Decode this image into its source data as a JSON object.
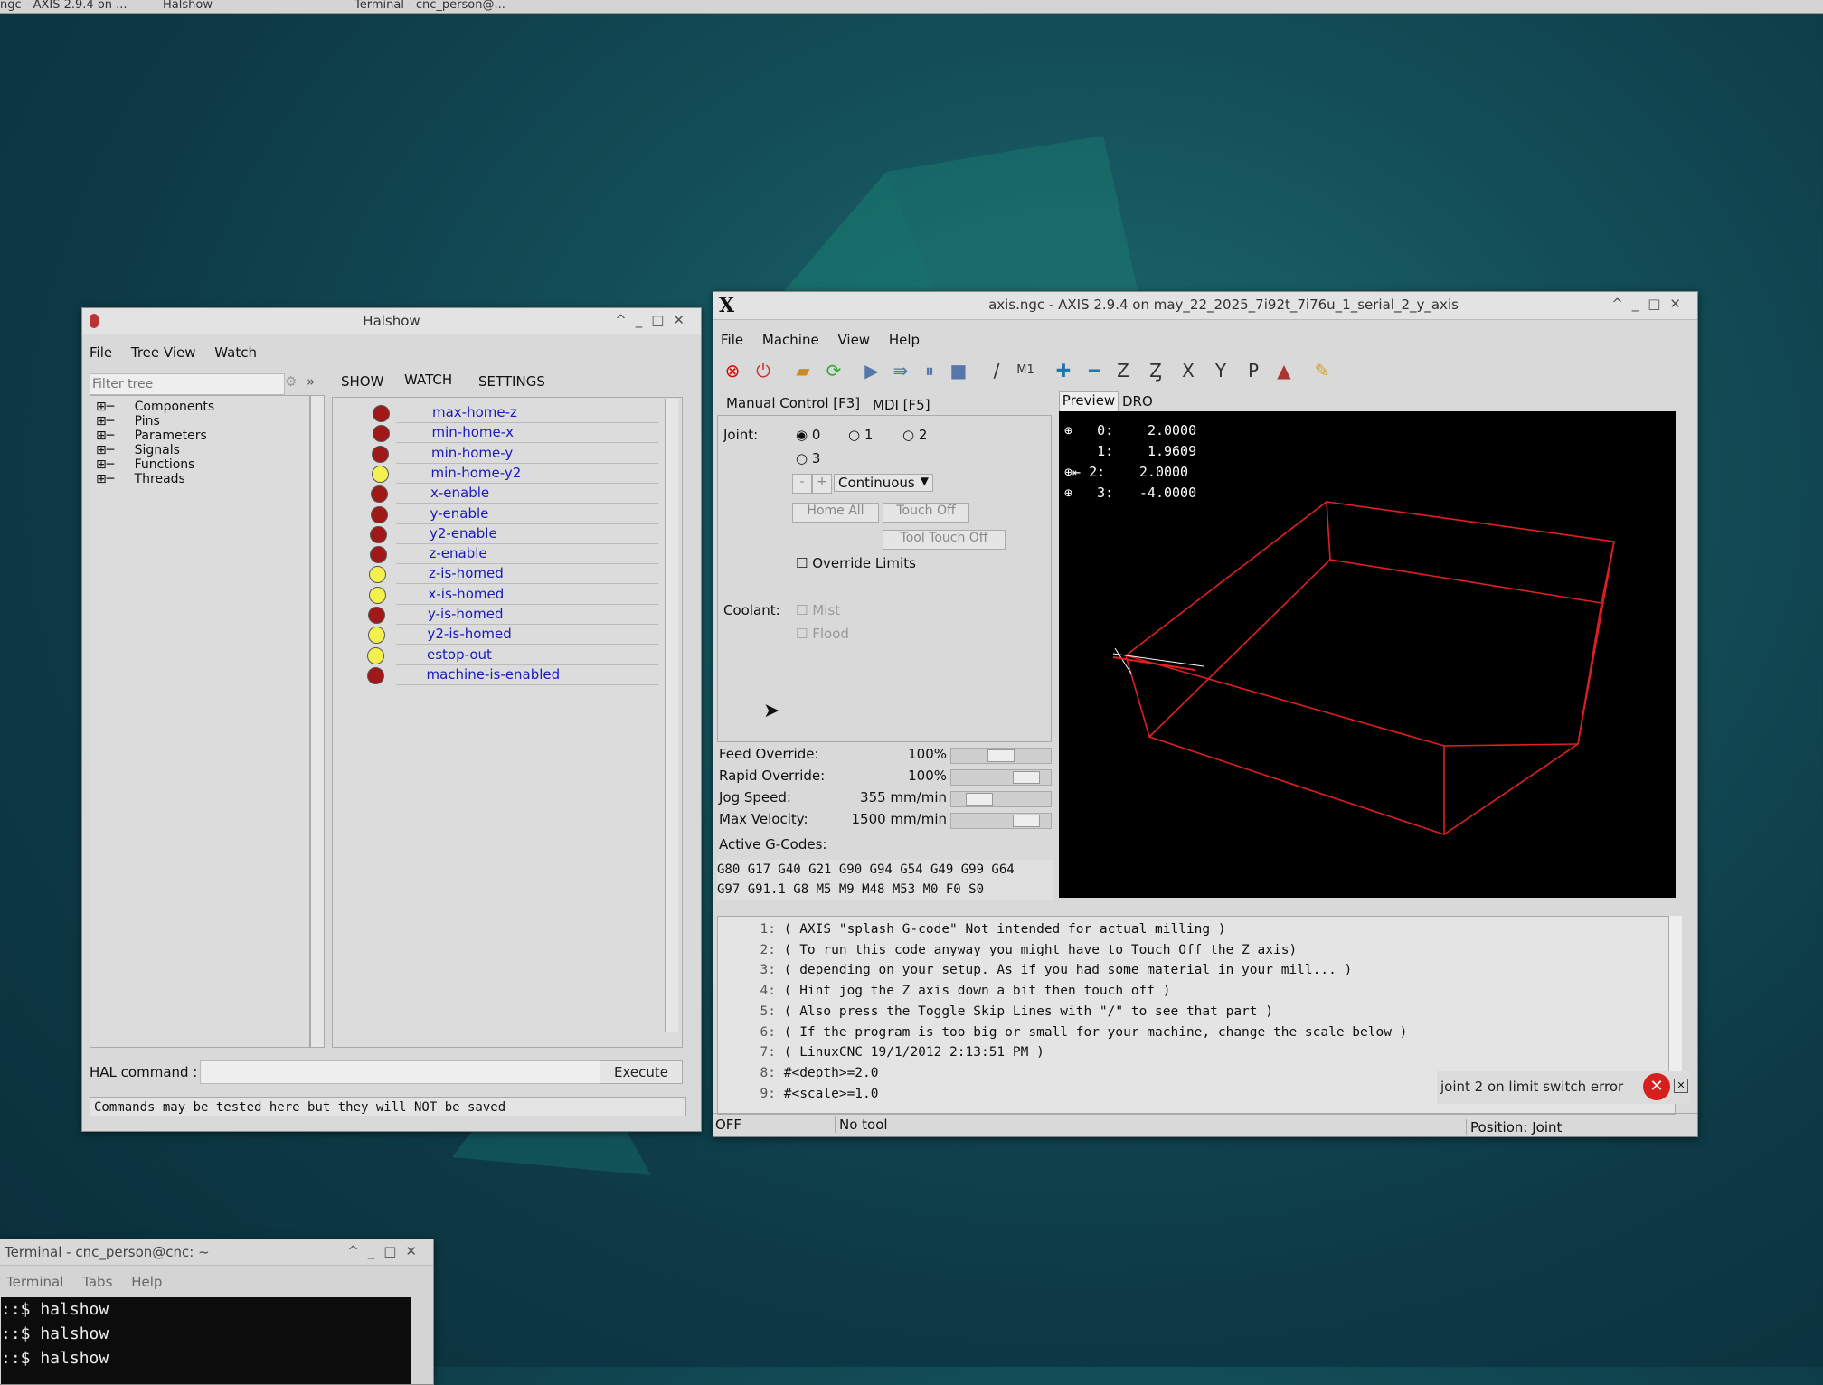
{
  "taskbar": {
    "items": [
      "ngc - AXIS 2.9.4 on ...",
      "Halshow",
      "Terminal - cnc_person@..."
    ]
  },
  "halshow": {
    "title": "Halshow",
    "menu": [
      "File",
      "Tree View",
      "Watch"
    ],
    "filter_placeholder": "Filter tree",
    "tabs": [
      "SHOW",
      "WATCH",
      "SETTINGS"
    ],
    "tree": [
      "Components",
      "Pins",
      "Parameters",
      "Signals",
      "Functions",
      "Threads"
    ],
    "watch": [
      {
        "name": "max-home-z",
        "state": "red"
      },
      {
        "name": "min-home-x",
        "state": "red"
      },
      {
        "name": "min-home-y",
        "state": "red"
      },
      {
        "name": "min-home-y2",
        "state": "yellow"
      },
      {
        "name": "x-enable",
        "state": "red"
      },
      {
        "name": "y-enable",
        "state": "red"
      },
      {
        "name": "y2-enable",
        "state": "red"
      },
      {
        "name": "z-enable",
        "state": "red"
      },
      {
        "name": "z-is-homed",
        "state": "yellow"
      },
      {
        "name": "x-is-homed",
        "state": "yellow"
      },
      {
        "name": "y-is-homed",
        "state": "red"
      },
      {
        "name": "y2-is-homed",
        "state": "yellow"
      },
      {
        "name": "estop-out",
        "state": "yellow"
      },
      {
        "name": "machine-is-enabled",
        "state": "red"
      }
    ],
    "hal_command_label": "HAL command :",
    "execute_label": "Execute",
    "status": "Commands may be tested here but they will NOT be saved"
  },
  "axis": {
    "title": "axis.ngc - AXIS 2.9.4 on may_22_2025_7i92t_7i76u_1_serial_2_y_axis",
    "menu": [
      "File",
      "Machine",
      "View",
      "Help"
    ],
    "tabs": [
      "Manual Control [F3]",
      "MDI [F5]"
    ],
    "joint_label": "Joint:",
    "joints": [
      "0",
      "1",
      "2",
      "3"
    ],
    "jog_minus": "-",
    "jog_plus": "+",
    "jog_mode": "Continuous",
    "home_all": "Home All",
    "touch_off": "Touch Off",
    "tool_touch_off": "Tool Touch Off",
    "override_limits": "Override Limits",
    "coolant_label": "Coolant:",
    "mist": "Mist",
    "flood": "Flood",
    "sliders": [
      {
        "label": "Feed Override:",
        "value": "100%",
        "level": 0.5
      },
      {
        "label": "Rapid Override:",
        "value": "100%",
        "level": 0.85
      },
      {
        "label": "Jog Speed:",
        "value": "355 mm/min",
        "level": 0.2
      },
      {
        "label": "Max Velocity:",
        "value": "1500 mm/min",
        "level": 0.85
      }
    ],
    "active_gcodes_label": "Active G-Codes:",
    "gcodes": [
      "G80 G17 G40 G21 G90 G94 G54 G49 G99 G64",
      "G97 G91.1 G8 M5 M9 M48 M53 M0 F0 S0"
    ],
    "view_tabs": [
      "Preview",
      "DRO"
    ],
    "dro": [
      {
        "label": "0:",
        "value": "2.0000"
      },
      {
        "label": "1:",
        "value": "1.9609"
      },
      {
        "label": "2:",
        "value": "2.0000"
      },
      {
        "label": "3:",
        "value": "-4.0000"
      }
    ],
    "gcode_lines": [
      {
        "n": "1:",
        "text": "( AXIS \"splash G-code\" Not intended for actual milling )"
      },
      {
        "n": "2:",
        "text": "( To run this code anyway you might have to Touch Off the Z axis)"
      },
      {
        "n": "3:",
        "text": "( depending on your setup. As if you had some material in your mill... )"
      },
      {
        "n": "4:",
        "text": "( Hint jog the Z axis down a bit then touch off )"
      },
      {
        "n": "5:",
        "text": "( Also press the Toggle Skip Lines with \"/\" to see that part )"
      },
      {
        "n": "6:",
        "text": "( If the program is too big or small for your machine, change the scale below )"
      },
      {
        "n": "7:",
        "text": "( LinuxCNC 19/1/2012 2:13:51 PM )"
      },
      {
        "n": "8:",
        "text": "#<depth>=2.0"
      },
      {
        "n": "9:",
        "text": "#<scale>=1.0"
      }
    ],
    "status_state": "OFF",
    "status_tool": "No tool",
    "status_position": "Position: Joint",
    "error_message": "joint 2 on limit switch error"
  },
  "terminal": {
    "title": "Terminal - cnc_person@cnc: ~",
    "menu": [
      "Terminal",
      "Tabs",
      "Help"
    ],
    "lines": [
      "::$ halshow",
      "::$ halshow",
      "::$ halshow"
    ]
  }
}
